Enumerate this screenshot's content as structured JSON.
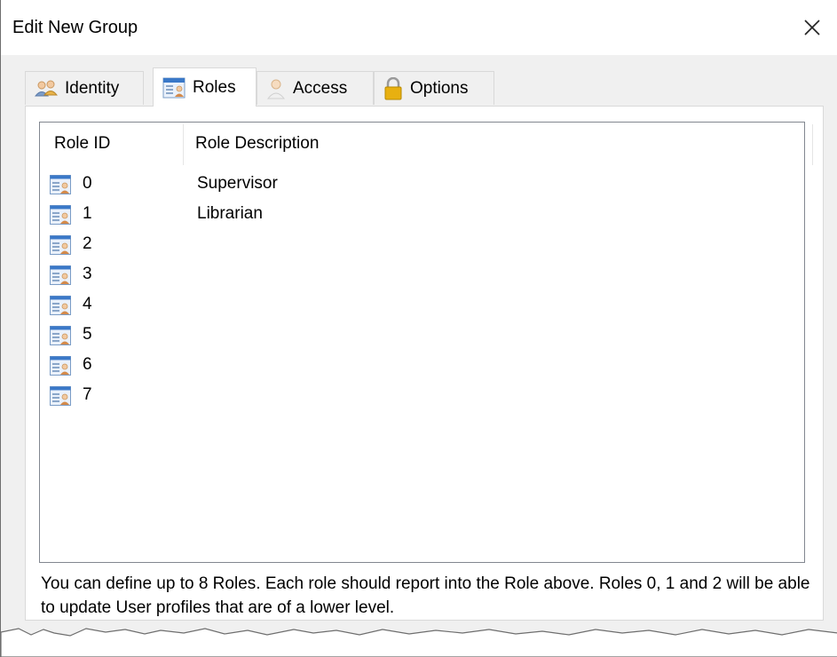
{
  "window": {
    "title": "Edit New Group",
    "close_glyph": "✕"
  },
  "tabs": [
    {
      "label": "Identity",
      "icon": "users-icon",
      "active": false
    },
    {
      "label": "Roles",
      "icon": "role-list-icon",
      "active": true
    },
    {
      "label": "Access",
      "icon": "person-icon",
      "active": false
    },
    {
      "label": "Options",
      "icon": "lock-icon",
      "active": false
    }
  ],
  "roles_list": {
    "columns": [
      "Role ID",
      "Role Description"
    ],
    "rows": [
      {
        "id": "0",
        "description": "Supervisor",
        "icon": "role-item-icon"
      },
      {
        "id": "1",
        "description": "Librarian",
        "icon": "role-item-icon"
      },
      {
        "id": "2",
        "description": "",
        "icon": "role-item-icon"
      },
      {
        "id": "3",
        "description": "",
        "icon": "role-item-icon"
      },
      {
        "id": "4",
        "description": "",
        "icon": "role-item-icon"
      },
      {
        "id": "5",
        "description": "",
        "icon": "role-item-icon"
      },
      {
        "id": "6",
        "description": "",
        "icon": "role-item-icon"
      },
      {
        "id": "7",
        "description": "",
        "icon": "role-item-icon"
      }
    ]
  },
  "help_text": "You can define up to 8 Roles. Each role should report into the Role above. Roles 0, 1 and 2 will be able to update User profiles that are of a lower level.",
  "colors": {
    "window_bg": "#f0f0f0",
    "panel_bg": "#ffffff",
    "lock_gold": "#e0a800",
    "icon_blue": "#3a78c8"
  }
}
